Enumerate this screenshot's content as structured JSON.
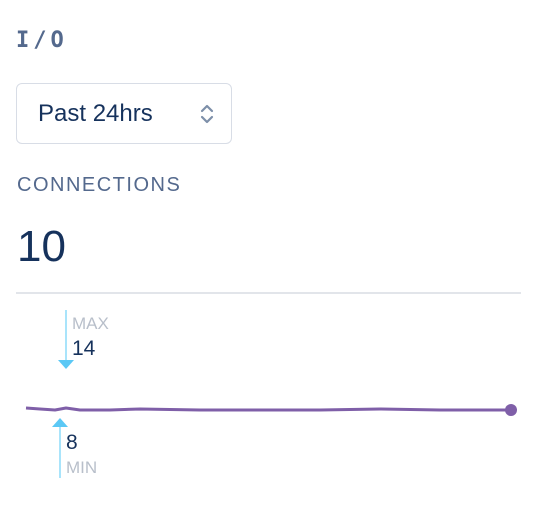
{
  "section": {
    "title": "I/O"
  },
  "time_select": {
    "value": "Past 24hrs",
    "icon": "chevron-updown-icon"
  },
  "metric": {
    "label": "CONNECTIONS",
    "value": "10"
  },
  "sparkline": {
    "max_label": "MAX",
    "max_value": "14",
    "min_label": "MIN",
    "min_value": "8",
    "line_color": "#7f5fa8",
    "marker_color": "#5bc8f5"
  }
}
